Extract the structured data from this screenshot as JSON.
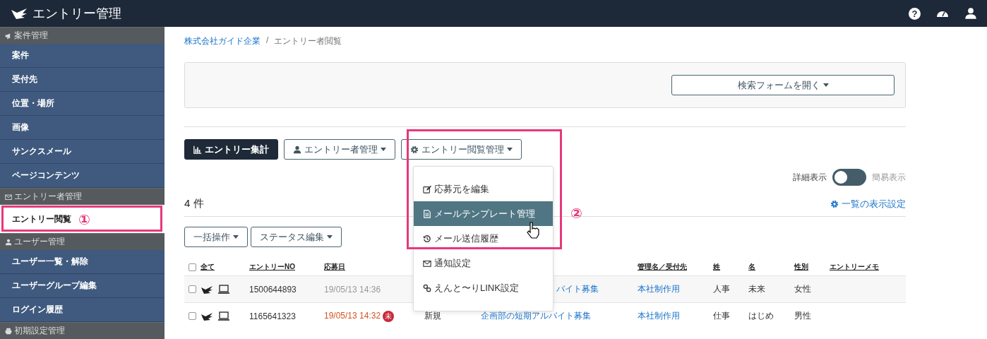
{
  "app_bar": {
    "title": "エントリー管理"
  },
  "sidebar": {
    "sections": [
      {
        "title": "案件管理",
        "items": [
          {
            "label": "案件",
            "selected": false
          },
          {
            "label": "受付先",
            "selected": false
          },
          {
            "label": "位置・場所",
            "selected": false
          },
          {
            "label": "画像",
            "selected": false
          },
          {
            "label": "サンクスメール",
            "selected": false
          },
          {
            "label": "ページコンテンツ",
            "selected": false
          }
        ]
      },
      {
        "title": "エントリー者管理",
        "items": [
          {
            "label": "エントリー閲覧",
            "selected": true
          }
        ]
      },
      {
        "title": "ユーザー管理",
        "items": [
          {
            "label": "ユーザー一覧・解除",
            "selected": false
          },
          {
            "label": "ユーザーグループ編集",
            "selected": false
          },
          {
            "label": "ログイン履歴",
            "selected": false
          }
        ]
      },
      {
        "title": "初期設定管理"
      }
    ]
  },
  "breadcrumb": {
    "separator": "/",
    "items": [
      {
        "label": "株式会社ガイド企業",
        "kind": "link"
      },
      {
        "label": "エントリー者閲覧",
        "kind": "current"
      }
    ]
  },
  "help_icon": "?",
  "search_panel": {
    "button": "検索フォームを開く"
  },
  "toolbar": [
    {
      "label": "エントリー集計",
      "kind": "primary"
    },
    {
      "label": "エントリー者管理",
      "kind": "dropdown"
    },
    {
      "label": "エントリー閲覧管理",
      "kind": "dropdown"
    }
  ],
  "dropdown_menu": {
    "items": [
      {
        "label": "応募元を編集",
        "selected": false
      },
      {
        "label": "メールテンプレート管理",
        "selected": true
      },
      {
        "label": "メール送信履歴",
        "selected": false
      },
      {
        "label": "通知設定",
        "selected": false
      },
      {
        "label": "えんと〜りLINK設定",
        "selected": false
      }
    ]
  },
  "view_toggle": {
    "left_label": "詳細表示",
    "right_label": "簡易表示",
    "on": false
  },
  "count": "4 件",
  "list_settings_link": "一覧の表示設定",
  "bulk_buttons": [
    "一括操作",
    "ステータス編集"
  ],
  "table": {
    "select_all_checked": false,
    "columns": [
      "全て",
      "エントリーNO",
      "応募日",
      "管理名／受付先",
      "姓",
      "名",
      "性別",
      "エントリーメモ"
    ],
    "rows": [
      {
        "checked": false,
        "entry_no": "1500644893",
        "date": "19/05/13 14:36",
        "unread": false,
        "job": "バイト募集",
        "job_covered": true,
        "recipient": "本社制作用",
        "last_name": "人事",
        "first_name": "未来",
        "gender": "女性"
      },
      {
        "checked": false,
        "entry_no": "1165641323",
        "date": "19/05/13 14:32",
        "unread": true,
        "badge": "未",
        "status": "新規",
        "job": "企画部の短期アルバイト募集",
        "job_covered": false,
        "recipient": "本社制作用",
        "last_name": "仕事",
        "first_name": "はじめ",
        "gender": "男性"
      }
    ]
  },
  "annotations": [
    {
      "label": "①"
    },
    {
      "label": "②"
    }
  ]
}
